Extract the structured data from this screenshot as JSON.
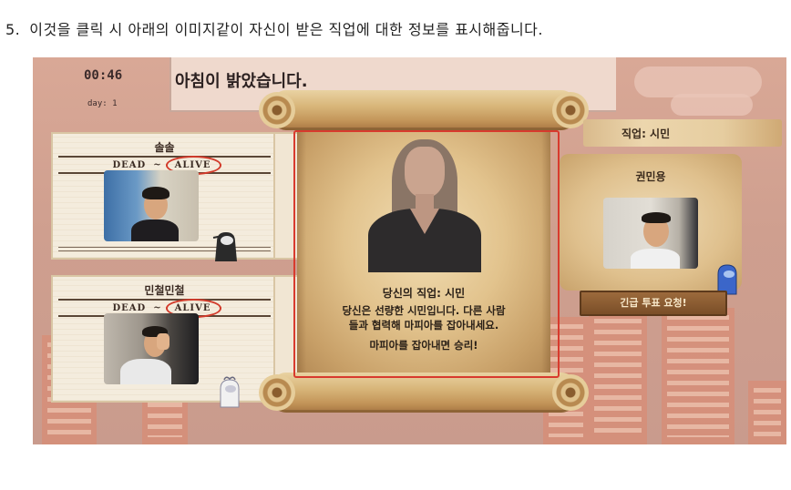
{
  "instruction": {
    "number": "5.",
    "text": "이것을 클릭 시 아래의 이미지같이 자신이 받은 직업에 대한 정보를 표시해줍니다."
  },
  "game": {
    "timer": "00:46",
    "day": "day: 1",
    "announcement": "아침이 밝았습니다.",
    "players": [
      {
        "name": "솔솔",
        "dead": "DEAD",
        "alive": "ALIVE"
      },
      {
        "name": "민철민철",
        "dead": "DEAD",
        "alive": "ALIVE"
      }
    ],
    "role_scroll": {
      "title": "당신의 직업: 시민",
      "line1": "당신은 선량한 시민입니다. 다른 사람",
      "line2": "들과 협력해 마피아를 잡아내세요.",
      "line3": "마피아를 잡아내면 승리!"
    },
    "self_panel": {
      "job_label": "직업: 시민",
      "name": "권민용",
      "vote_button": "긴급 투표 요청!"
    }
  },
  "colors": {
    "highlight": "#d83a2e",
    "alive_circle": "#d23a2a",
    "background_sky": "#d9a896"
  }
}
